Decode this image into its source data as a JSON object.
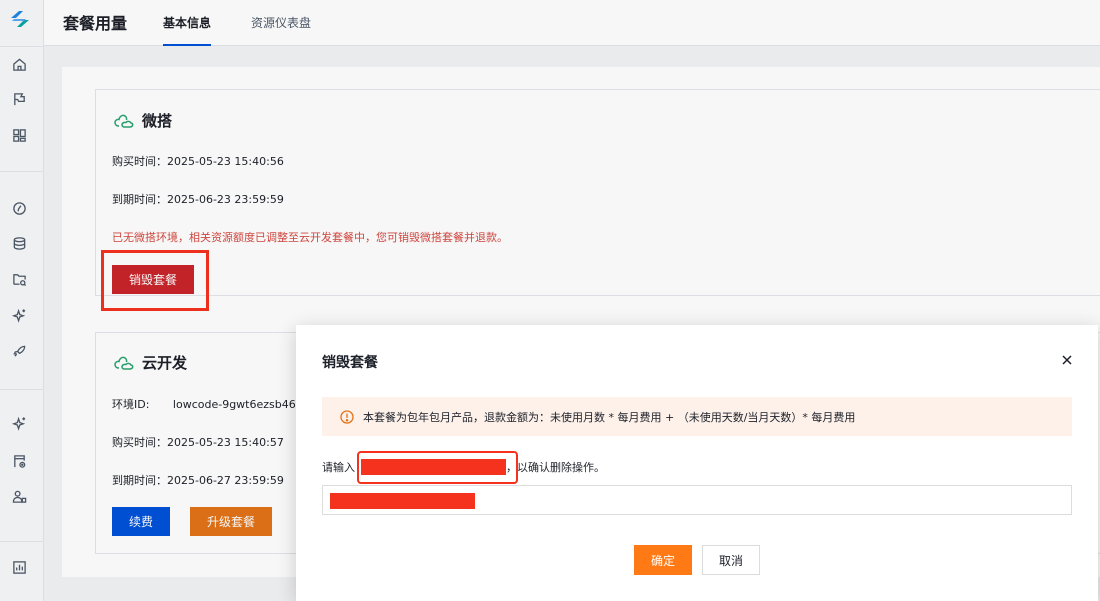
{
  "header": {
    "title": "套餐用量",
    "tabs": [
      {
        "label": "基本信息",
        "active": true
      },
      {
        "label": "资源仪表盘",
        "active": false
      }
    ]
  },
  "sidebar": {
    "icons": [
      "logo-icon",
      "home-icon",
      "flag-icon",
      "grid-icon",
      "compass-icon",
      "database-icon",
      "folder-search-icon",
      "sparkle-icon",
      "rocket-icon",
      "magic-icon",
      "file-view-icon",
      "users-icon",
      "chart-icon"
    ]
  },
  "weida_card": {
    "title": "微搭",
    "purchase_time": "购买时间：2025-05-23 15:40:56",
    "expire_time": "到期时间：2025-06-23 23:59:59",
    "warning": "已无微搭环境，相关资源额度已调整至云开发套餐中，您可销毁微搭套餐并退款。",
    "destroy_button": "销毁套餐"
  },
  "cloud_card": {
    "title": "云开发",
    "env_label": "环境ID:",
    "env_value": "lowcode-9gwt6ezsb46",
    "purchase_time": "购买时间：2025-05-23 15:40:57",
    "expire_time": "到期时间：2025-06-27 23:59:59",
    "renew_button": "续费",
    "upgrade_button": "升级套餐"
  },
  "modal": {
    "title": "销毁套餐",
    "notice": "本套餐为包年包月产品，退款金额为：未使用月数 * 每月费用 + （未使用天数/当月天数）* 每月费用",
    "prompt_prefix": "请输入",
    "prompt_suffix": "，以确认删除操作。",
    "input_value": "",
    "ok_button": "确定",
    "cancel_button": "取消"
  },
  "colors": {
    "primary": "#0052d9",
    "warning_red": "#d54941",
    "destroy_button": "#c9252b",
    "orange": "#ff7a14",
    "upgrade_orange": "#e37318",
    "highlight": "#f5321e"
  }
}
